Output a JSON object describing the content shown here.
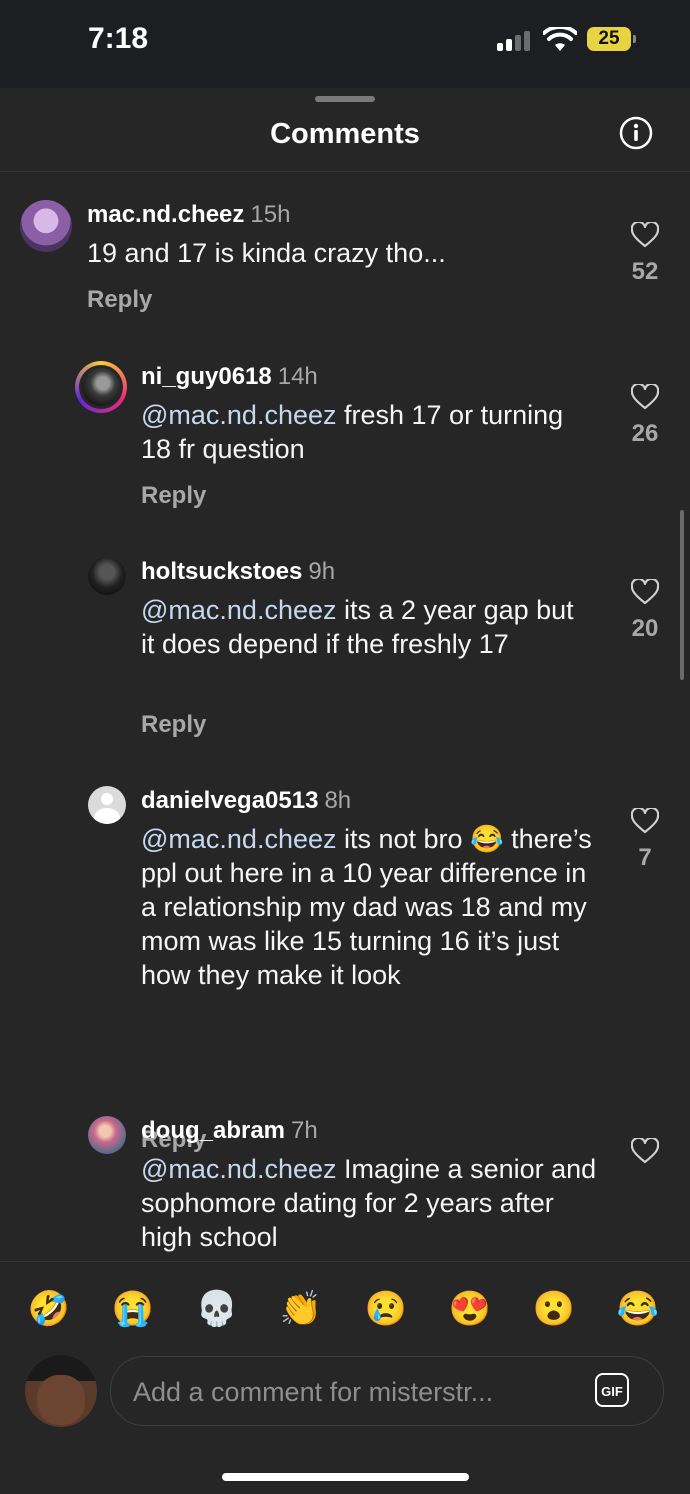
{
  "status_bar": {
    "time": "7:18",
    "battery": "25"
  },
  "header": {
    "title": "Comments"
  },
  "comments": [
    {
      "username": "mac.nd.cheez",
      "time": "15h",
      "mention": "",
      "text": "19 and 17 is kinda crazy tho...",
      "reply": "Reply",
      "likes": "52"
    },
    {
      "username": "ni_guy0618",
      "time": "14h",
      "mention": "@mac.nd.cheez",
      "text": " fresh 17 or turning 18 fr question",
      "reply": "Reply",
      "likes": "26"
    },
    {
      "username": "holtsuckstoes",
      "time": "9h",
      "mention": "@mac.nd.cheez",
      "text": " its a 2 year gap but it does depend if the freshly 17",
      "reply": "Reply",
      "likes": "20"
    },
    {
      "username": "danielvega0513",
      "time": "8h",
      "mention": "@mac.nd.cheez",
      "text": " its not bro 😂 there’s ppl out here in a 10 year difference in a relationship  my dad  was 18 and my mom was like 15 turning 16 it’s just how they make it look",
      "reply": "Reply",
      "likes": "7"
    },
    {
      "username": "doug_abram",
      "time": "7h",
      "mention": "@mac.nd.cheez",
      "text": " Imagine a senior and sophomore dating for 2 years after high school",
      "reply": "",
      "likes": ""
    }
  ],
  "emoji_bar": [
    "🤣",
    "😭",
    "💀",
    "👏",
    "😢",
    "😍",
    "😮",
    "😂"
  ],
  "composer": {
    "placeholder": "Add a comment for misterstr...",
    "gif_label": "GIF"
  },
  "icons": {
    "like": "heart-outline-icon",
    "info": "info-icon"
  },
  "colors": {
    "background": "#262626",
    "mention": "#c6d7f0",
    "battery": "#e8d443"
  }
}
